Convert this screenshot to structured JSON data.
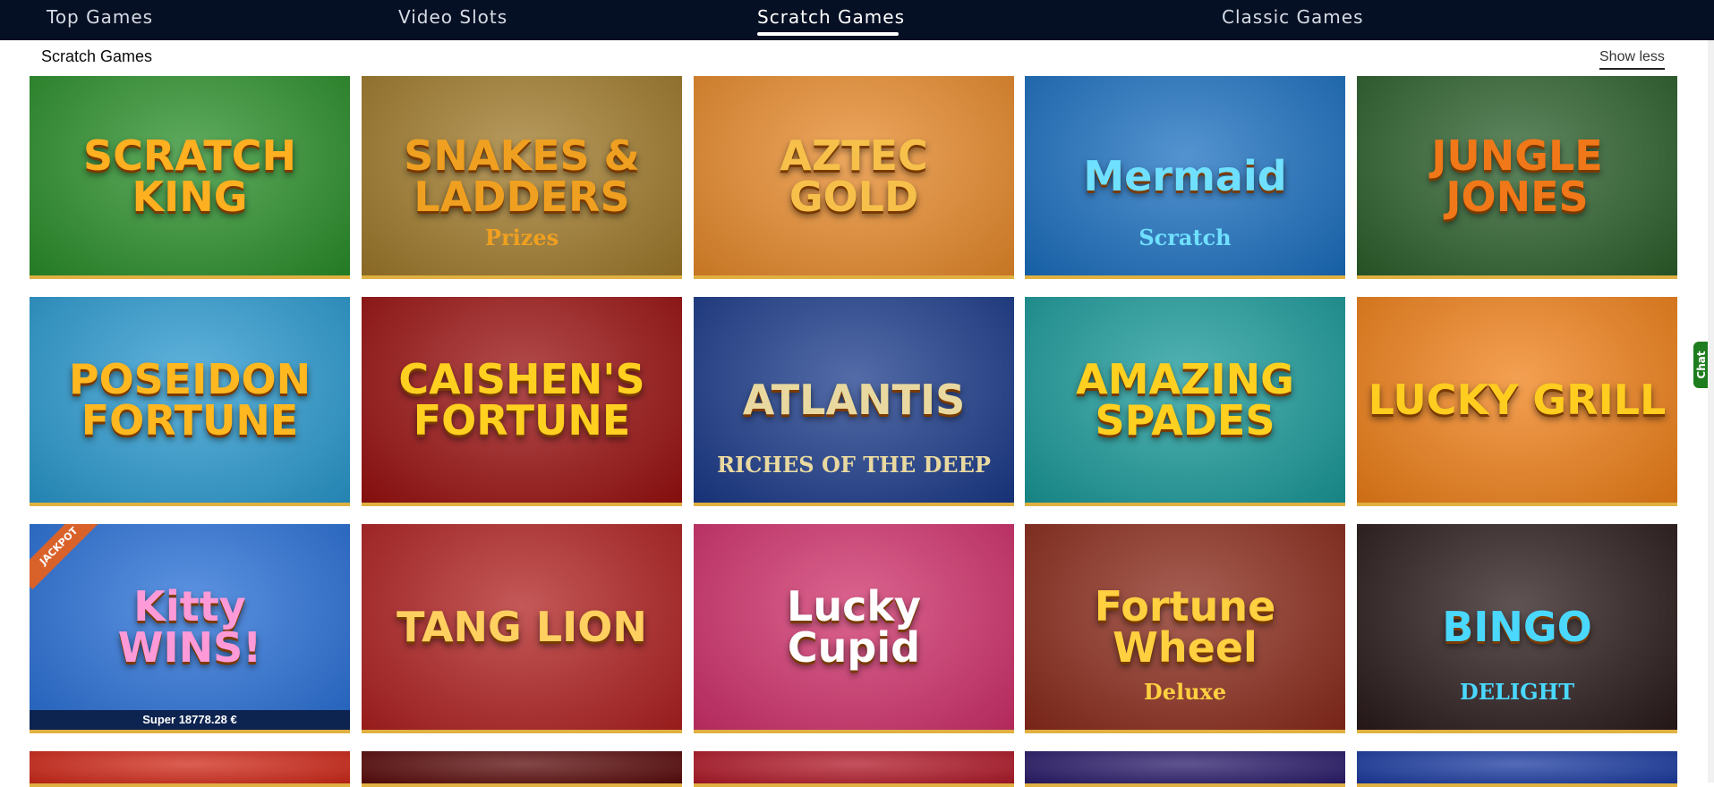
{
  "nav": {
    "tabs": [
      {
        "label": "Top Games"
      },
      {
        "label": "Video Slots"
      },
      {
        "label": "Scratch Games"
      },
      {
        "label": "Classic Games"
      }
    ],
    "active_tab": "Scratch Games"
  },
  "section": {
    "title": "Scratch Games",
    "toggle_label": "Show less"
  },
  "games": [
    {
      "title": "SCRATCH\nKING",
      "bg": "#2a8f2a",
      "color": "#ffb020"
    },
    {
      "title": "SNAKES &\nLADDERS",
      "subtitle": "Prizes",
      "bg": "#a07a2a",
      "color": "#f0a020"
    },
    {
      "title": "AZTEC\nGOLD",
      "bg": "#e88a2a",
      "color": "#f7c04a"
    },
    {
      "title": "Mermaid",
      "subtitle": "Scratch",
      "bg": "#1a6fc0",
      "color": "#6fe0ff"
    },
    {
      "title": "JUNGLE\nJONES",
      "bg": "#2b5f2b",
      "color": "#f07818"
    },
    {
      "title": "POSEIDON\nFORTUNE",
      "bg": "#2a9ad0",
      "color": "#ffb820"
    },
    {
      "title": "CAISHEN'S\nFORTUNE",
      "bg": "#9a1010",
      "color": "#ffd020"
    },
    {
      "title": "ATLANTIS",
      "subtitle": "RICHES OF THE DEEP",
      "bg": "#1a3a8a",
      "color": "#e9d9a0"
    },
    {
      "title": "AMAZING\nSPADES",
      "bg": "#1a9a9a",
      "color": "#ffd020"
    },
    {
      "title": "LUCKY GRILL",
      "bg": "#f08018",
      "color": "#ffcc20"
    },
    {
      "title": "Kitty\nWINS!",
      "bg": "#2870d8",
      "color": "#ff9ad8",
      "jackpot_label": "JACKPOT",
      "jackpot_text": "Super  18778.28 €"
    },
    {
      "title": "TANG LION",
      "bg": "#b02020",
      "color": "#ffd060"
    },
    {
      "title": "Lucky\nCupid",
      "bg": "#d0306a",
      "color": "#ffffff"
    },
    {
      "title": "Fortune\nWheel",
      "subtitle": "Deluxe",
      "bg": "#8a2a1a",
      "color": "#ffd040"
    },
    {
      "title": "BINGO",
      "subtitle": "DELIGHT",
      "bg": "#2a1a1a",
      "color": "#4ad8ff"
    },
    {
      "title": "",
      "bg": "#d02818",
      "color": "#ffd020"
    },
    {
      "title": "",
      "bg": "#5a0a0a",
      "color": "#ffd020"
    },
    {
      "title": "",
      "bg": "#b01828",
      "color": "#ffffff"
    },
    {
      "title": "",
      "bg": "#2a1a6a",
      "color": "#ffffff"
    },
    {
      "title": "",
      "bg": "#1a3aa0",
      "color": "#ffd020"
    }
  ],
  "chat": {
    "label": "Chat"
  },
  "colors": {
    "nav_bg": "#061024",
    "accent": "#ffffff",
    "tile_border": "#e0b040"
  }
}
